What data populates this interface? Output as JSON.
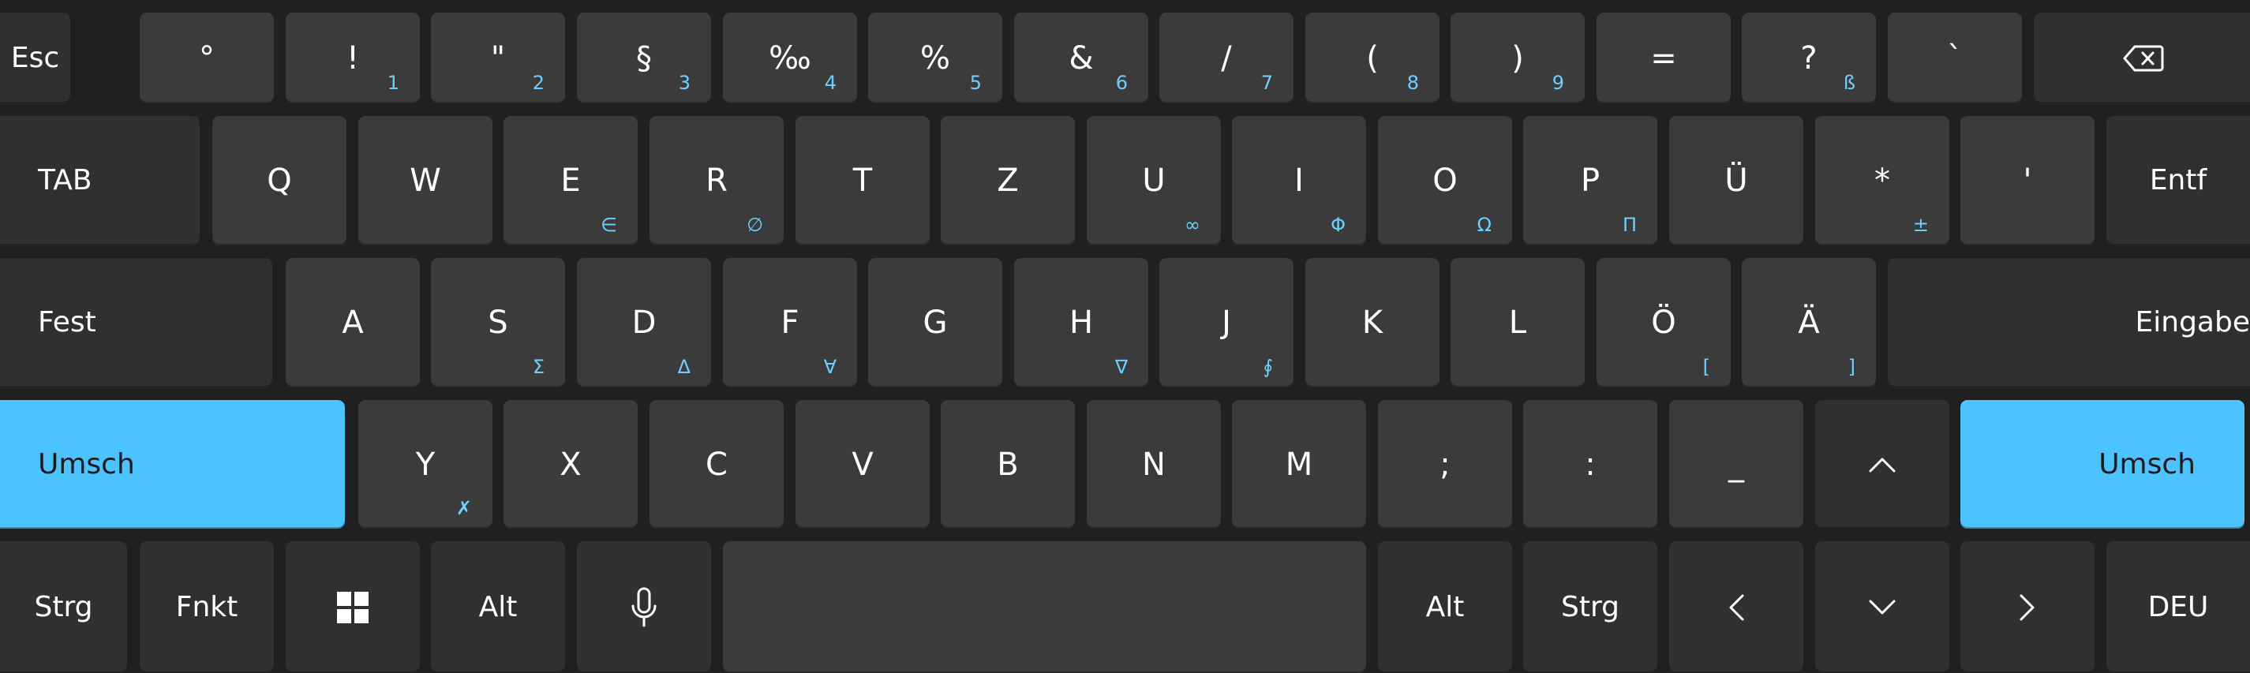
{
  "keyboard": {
    "layout_language": "DEU",
    "colors": {
      "background": "#202020",
      "key": "#3b3b3b",
      "key_dark": "#303030",
      "accent": "#4cc2ff",
      "secondary_symbol": "#6fd0ff"
    },
    "row1": {
      "esc": "Esc",
      "degree": "°",
      "k1": {
        "main": "!",
        "sub": "1"
      },
      "k2": {
        "main": "\"",
        "sub": "2"
      },
      "k3": {
        "main": "§",
        "sub": "3"
      },
      "k4": {
        "main": "‰",
        "sub": "4"
      },
      "k5": {
        "main": "%",
        "sub": "5"
      },
      "k6": {
        "main": "&",
        "sub": "6"
      },
      "k7": {
        "main": "/",
        "sub": "7"
      },
      "k8": {
        "main": "(",
        "sub": "8"
      },
      "k9": {
        "main": ")",
        "sub": "9"
      },
      "k0": {
        "main": "="
      },
      "sz": {
        "main": "?",
        "sub": "ß"
      },
      "accent": {
        "main": "`"
      },
      "backspace_icon": "backspace-icon"
    },
    "row2": {
      "tab": "TAB",
      "q": {
        "main": "Q"
      },
      "w": {
        "main": "W"
      },
      "e": {
        "main": "E",
        "sub": "∈"
      },
      "r": {
        "main": "R",
        "sub": "∅"
      },
      "t": {
        "main": "T"
      },
      "z": {
        "main": "Z"
      },
      "u": {
        "main": "U",
        "sub": "∞"
      },
      "i": {
        "main": "I",
        "sub": "Φ"
      },
      "o": {
        "main": "O",
        "sub": "Ω"
      },
      "p": {
        "main": "P",
        "sub": "Π"
      },
      "ue": {
        "main": "Ü"
      },
      "plus": {
        "main": "*",
        "sub": "±"
      },
      "hash": {
        "main": "'"
      },
      "delete": "Entf"
    },
    "row3": {
      "caps": "Fest",
      "a": {
        "main": "A"
      },
      "s": {
        "main": "S",
        "sub": "Σ"
      },
      "d": {
        "main": "D",
        "sub": "Δ"
      },
      "f": {
        "main": "F",
        "sub": "∀"
      },
      "g": {
        "main": "G"
      },
      "h": {
        "main": "H",
        "sub": "∇"
      },
      "j": {
        "main": "J",
        "sub": "∮"
      },
      "k": {
        "main": "K"
      },
      "l": {
        "main": "L"
      },
      "oe": {
        "main": "Ö",
        "sub": "["
      },
      "ae": {
        "main": "Ä",
        "sub": "]"
      },
      "enter": "Eingabe"
    },
    "row4": {
      "shift_left": "Umsch",
      "y": {
        "main": "Y",
        "sub": "✗"
      },
      "x": {
        "main": "X"
      },
      "c": {
        "main": "C"
      },
      "v": {
        "main": "V"
      },
      "b": {
        "main": "B"
      },
      "n": {
        "main": "N"
      },
      "m": {
        "main": "M"
      },
      "comma": {
        "main": ";"
      },
      "period": {
        "main": ":"
      },
      "minus": {
        "main": "_"
      },
      "up_icon": "arrow-up-icon",
      "shift_right": "Umsch"
    },
    "row5": {
      "ctrl_left": "Strg",
      "fn": "Fnkt",
      "windows_icon": "windows-icon",
      "alt_left": "Alt",
      "mic_icon": "microphone-icon",
      "space": "",
      "alt_right": "Alt",
      "ctrl_right": "Strg",
      "left_icon": "arrow-left-icon",
      "down_icon": "arrow-down-icon",
      "right_icon": "arrow-right-icon",
      "language": "DEU"
    }
  }
}
